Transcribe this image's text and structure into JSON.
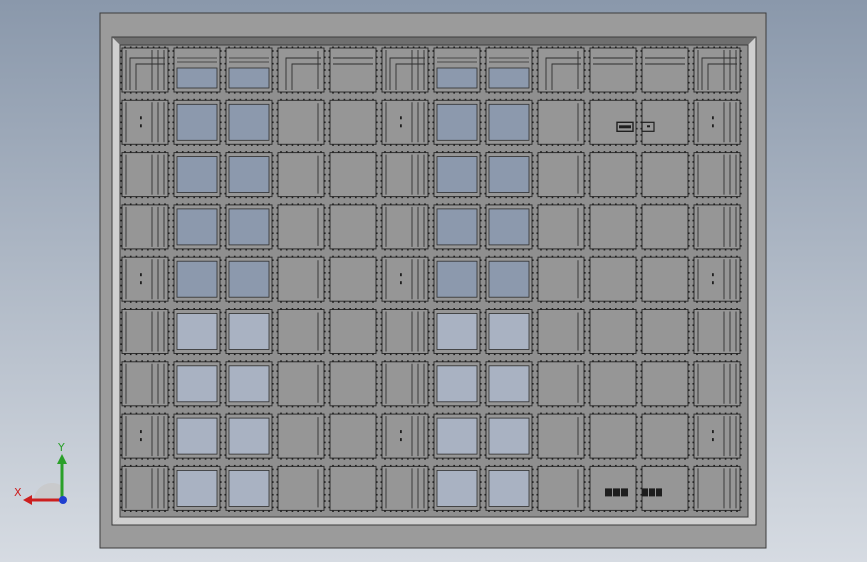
{
  "viewport": {
    "background_top": "#8a98ab",
    "background_bottom": "#d6dbe2"
  },
  "model": {
    "type": "rack-panel-assembly",
    "grid": {
      "rows": 9,
      "cols": 12
    },
    "colors": {
      "frame": "#9b9b9b",
      "frame_edge": "#3c3c3c",
      "bevel_light": "#cfcfcf",
      "bevel_dark": "#6f6f6f",
      "inner_field": "#8f8f8f",
      "cell": "#969696",
      "cell_edge": "#2f2f2f",
      "blue_window": "#8c99ad",
      "blue_window_light": "#a9b2c2",
      "slot_dark": "#1e1e1e"
    },
    "blue_columns": [
      1,
      2,
      6,
      7
    ],
    "detail_marks": [
      {
        "kind": "connector-pair",
        "row": 1,
        "col": 9
      },
      {
        "kind": "terminal-block",
        "row": 8,
        "col": 9
      }
    ]
  },
  "triad": {
    "x_label": "X",
    "y_label": "Y",
    "x_color": "#cc1f1f",
    "y_color": "#2aa02a",
    "z_color": "#1f3fd0"
  }
}
